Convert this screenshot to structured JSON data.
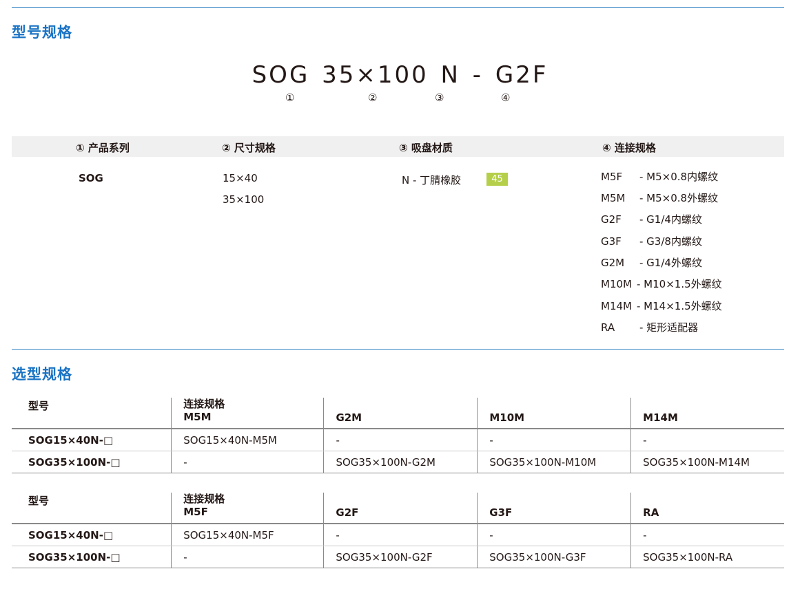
{
  "section1_title": "型号规格",
  "model_code": "SOG 35×100 N - G2F",
  "markers": [
    "①",
    "②",
    "③",
    "④"
  ],
  "spec_headers": [
    "① 产品系列",
    "② 尺寸规格",
    "③ 吸盘材质",
    "④ 连接规格"
  ],
  "series": "SOG",
  "sizes": [
    "15×40",
    "35×100"
  ],
  "material": "N - 丁腈橡胶",
  "hardness_badge": "45",
  "badge_color": "#b5cf4a",
  "connections": [
    {
      "code": "M5F",
      "desc": "- M5×0.8内螺纹"
    },
    {
      "code": "M5M",
      "desc": "- M5×0.8外螺纹"
    },
    {
      "code": "G2F",
      "desc": "- G1/4内螺纹"
    },
    {
      "code": "G3F",
      "desc": "- G3/8内螺纹"
    },
    {
      "code": "G2M",
      "desc": "- G1/4外螺纹"
    },
    {
      "code": "M10M",
      "desc": "- M10×1.5外螺纹"
    },
    {
      "code": "M14M",
      "desc": "- M14×1.5外螺纹"
    },
    {
      "code": "RA",
      "desc": "- 矩形适配器"
    }
  ],
  "section2_title": "选型规格",
  "table1": {
    "model_header": "型号",
    "conn_header": "连接规格",
    "cols": [
      "M5M",
      "G2M",
      "M10M",
      "M14M"
    ],
    "rows": [
      {
        "model": "SOG15×40N-□",
        "cells": [
          "SOG15×40N-M5M",
          "-",
          "-",
          "-"
        ]
      },
      {
        "model": "SOG35×100N-□",
        "cells": [
          "-",
          "SOG35×100N-G2M",
          "SOG35×100N-M10M",
          "SOG35×100N-M14M"
        ]
      }
    ]
  },
  "table2": {
    "model_header": "型号",
    "conn_header": "连接规格",
    "cols": [
      "M5F",
      "G2F",
      "G3F",
      "RA"
    ],
    "rows": [
      {
        "model": "SOG15×40N-□",
        "cells": [
          "SOG15×40N-M5F",
          "-",
          "-",
          "-"
        ]
      },
      {
        "model": "SOG35×100N-□",
        "cells": [
          "-",
          "SOG35×100N-G2F",
          "SOG35×100N-G3F",
          "SOG35×100N-RA"
        ]
      }
    ]
  }
}
